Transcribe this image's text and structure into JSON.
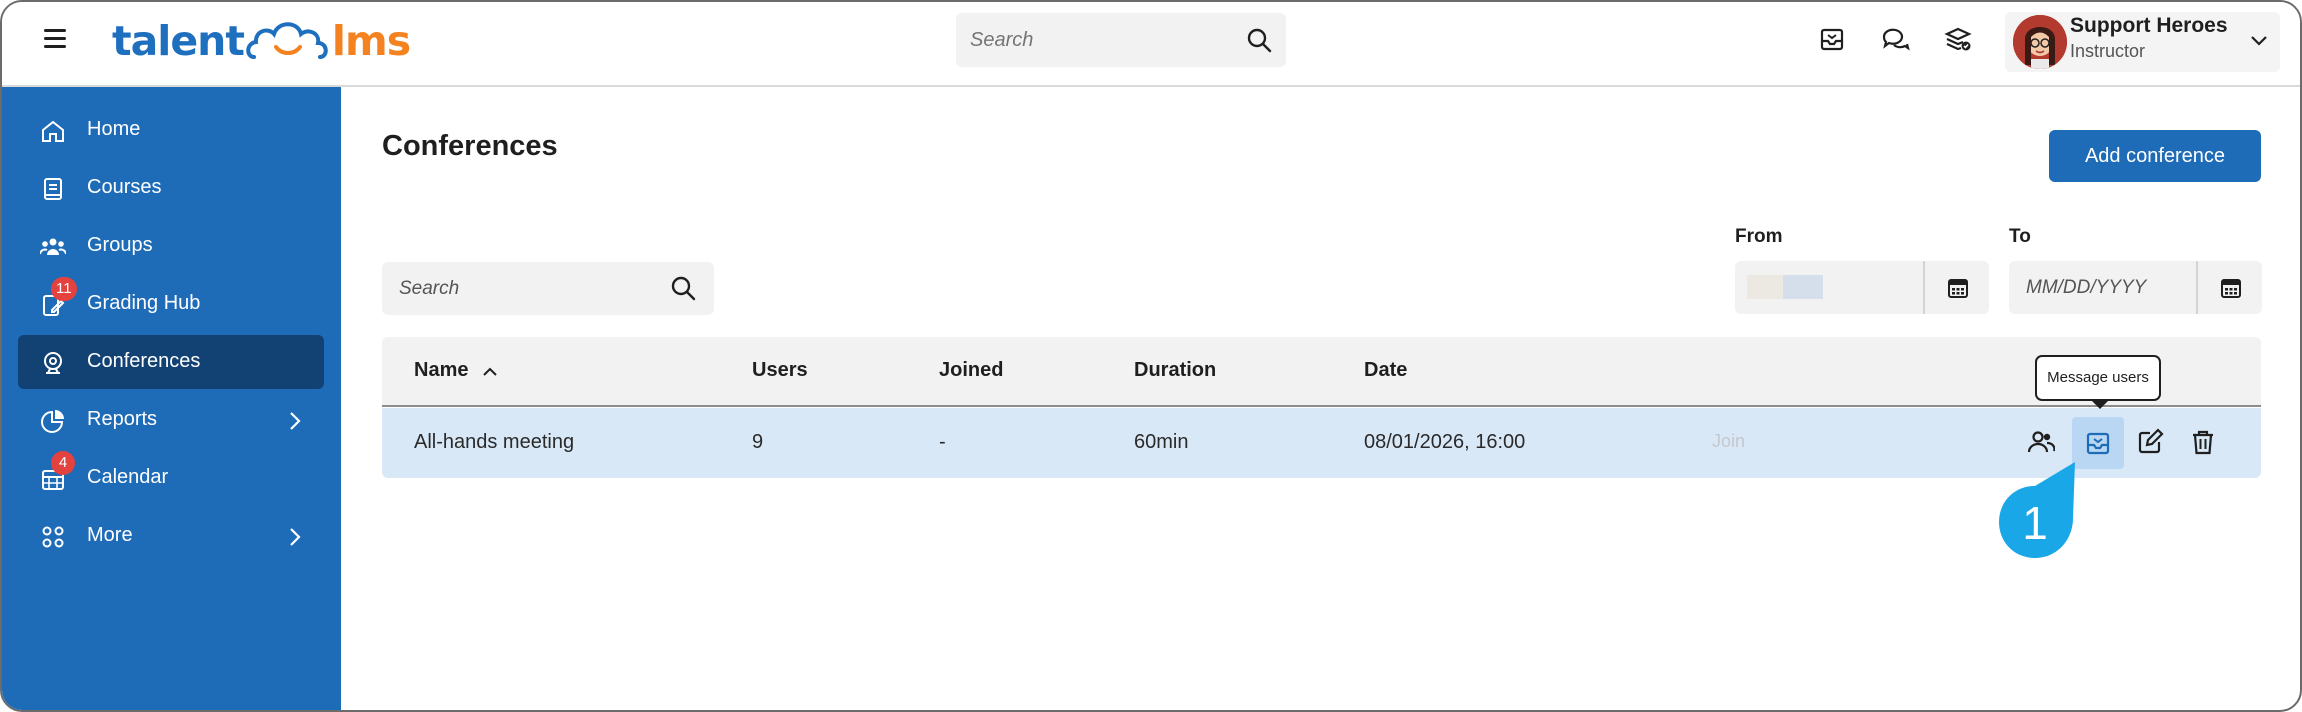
{
  "app": {
    "logo_part1": "talent",
    "logo_part2": "lms"
  },
  "header": {
    "search_placeholder": "Search",
    "icons": [
      "inbox-icon",
      "chat-icon",
      "stack-check-icon"
    ],
    "user": {
      "name": "Support Heroes",
      "role": "Instructor"
    }
  },
  "sidebar": {
    "items": [
      {
        "label": "Home",
        "icon": "home-icon"
      },
      {
        "label": "Courses",
        "icon": "book-icon"
      },
      {
        "label": "Groups",
        "icon": "group-icon"
      },
      {
        "label": "Grading Hub",
        "icon": "grading-icon",
        "badge": "11"
      },
      {
        "label": "Conferences",
        "icon": "webcam-icon",
        "active": true
      },
      {
        "label": "Reports",
        "icon": "pie-chart-icon"
      },
      {
        "label": "Calendar",
        "icon": "calendar-icon",
        "badge": "4"
      },
      {
        "label": "More",
        "icon": "grid-icon"
      }
    ]
  },
  "main": {
    "title": "Conferences",
    "add_button": "Add conference",
    "search_placeholder": "Search",
    "from_label": "From",
    "to_label": "To",
    "to_placeholder": "MM/DD/YYYY",
    "table": {
      "headers": [
        "Name",
        "Users",
        "Joined",
        "Duration",
        "Date"
      ],
      "rows": [
        {
          "name": "All-hands meeting",
          "users": "9",
          "joined": "-",
          "duration": "60min",
          "date": "08/01/2026, 16:00",
          "join": "Join"
        }
      ]
    },
    "tooltip": "Message users",
    "step_number": "1"
  },
  "colors": {
    "sidebar": "#1e6bb8",
    "sidebar_active": "#124273",
    "primary_button": "#1e6bb8",
    "row_highlight": "#d9e8f7",
    "badge": "#e4423f",
    "step_marker": "#1aa7e8",
    "logo_blue": "#1f6fbf",
    "logo_orange": "#f58220"
  }
}
